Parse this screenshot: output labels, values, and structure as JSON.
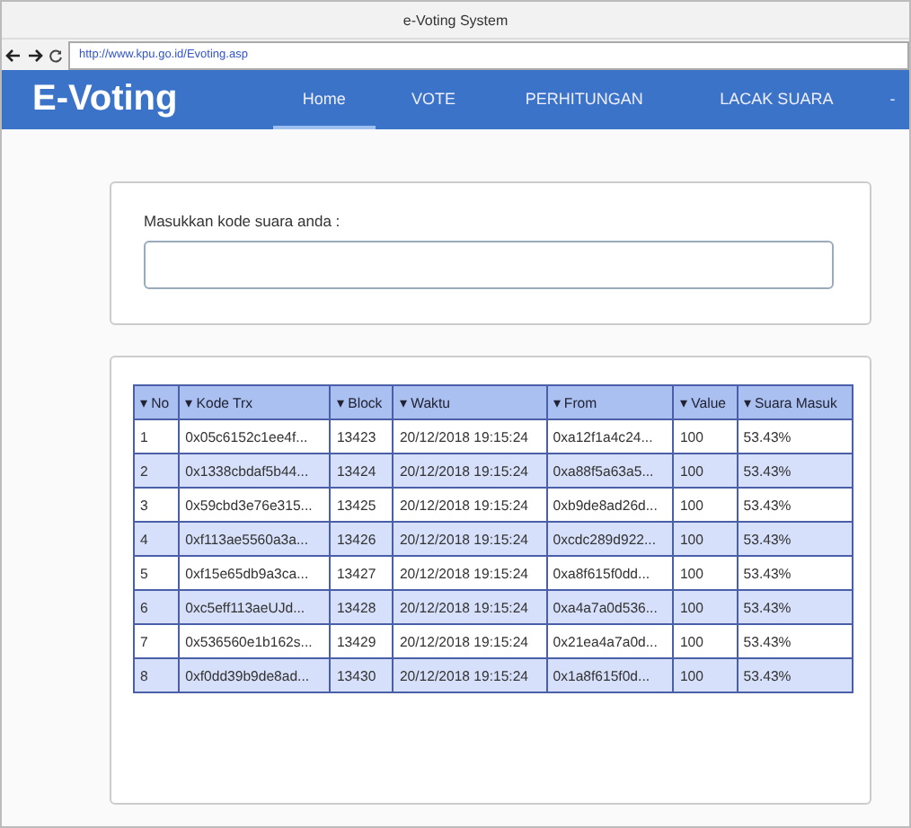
{
  "window": {
    "title": "e-Voting System"
  },
  "address_bar": {
    "url": "http://www.kpu.go.id/Evoting.asp"
  },
  "navbar": {
    "brand": "E-Voting",
    "items": [
      {
        "label": "Home",
        "selected": true
      },
      {
        "label": "VOTE",
        "selected": false
      },
      {
        "label": "PERHITUNGAN",
        "selected": false
      },
      {
        "label": "LACAK SUARA",
        "selected": false
      },
      {
        "label": "-",
        "selected": false
      }
    ]
  },
  "code_form": {
    "label": "Masukkan kode suara anda :"
  },
  "table": {
    "columns": [
      "No",
      "Kode Trx",
      "Block",
      "Waktu",
      "From",
      "Value",
      "Suara Masuk"
    ],
    "sort_icon": "▾",
    "rows": [
      [
        "1",
        "0x05c6152c1ee4f...",
        "13423",
        "20/12/2018 19:15:24",
        "0xa12f1a4c24...",
        "100",
        "53.43%"
      ],
      [
        "2",
        "0x1338cbdaf5b44...",
        "13424",
        "20/12/2018 19:15:24",
        "0xa88f5a63a5...",
        "100",
        "53.43%"
      ],
      [
        "3",
        "0x59cbd3e76e315...",
        "13425",
        "20/12/2018 19:15:24",
        "0xb9de8ad26d...",
        "100",
        "53.43%"
      ],
      [
        "4",
        "0xf113ae5560a3a...",
        "13426",
        "20/12/2018 19:15:24",
        "0xcdc289d922...",
        "100",
        "53.43%"
      ],
      [
        "5",
        "0xf15e65db9a3ca...",
        "13427",
        "20/12/2018 19:15:24",
        "0xa8f615f0dd...",
        "100",
        "53.43%"
      ],
      [
        "6",
        "0xc5eff113aeUJd...",
        "13428",
        "20/12/2018 19:15:24",
        "0xa4a7a0d536...",
        "100",
        "53.43%"
      ],
      [
        "7",
        "0x536560e1b162s...",
        "13429",
        "20/12/2018 19:15:24",
        "0x21ea4a7a0d...",
        "100",
        "53.43%"
      ],
      [
        "8",
        "0xf0dd39b9de8ad...",
        "13430",
        "20/12/2018 19:15:24",
        "0x1a8f615f0d...",
        "100",
        "53.43%"
      ]
    ]
  }
}
